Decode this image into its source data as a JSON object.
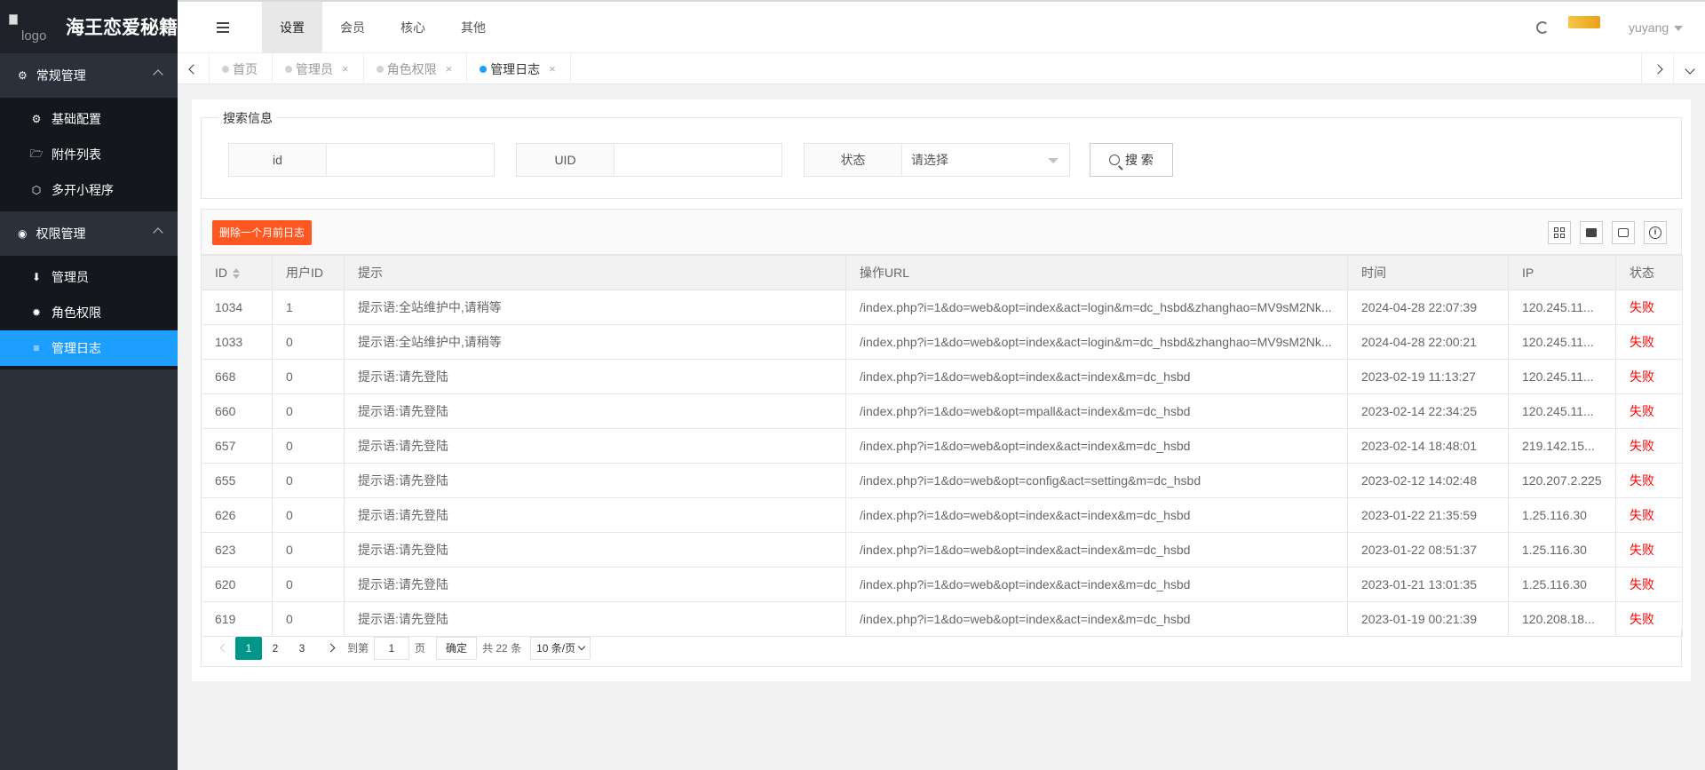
{
  "sidebar": {
    "logo_alt": "logo",
    "title": "海王恋爱秘籍",
    "groups": [
      {
        "label": "常规管理",
        "items": [
          {
            "label": "基础配置"
          },
          {
            "label": "附件列表"
          },
          {
            "label": "多开小程序"
          }
        ]
      },
      {
        "label": "权限管理",
        "items": [
          {
            "label": "管理员"
          },
          {
            "label": "角色权限"
          },
          {
            "label": "管理日志"
          }
        ]
      }
    ]
  },
  "topbar": {
    "nav": [
      "设置",
      "会员",
      "核心",
      "其他"
    ],
    "active_nav": "设置",
    "user": "yuyang"
  },
  "tabs": [
    {
      "label": "首页"
    },
    {
      "label": "管理员"
    },
    {
      "label": "角色权限"
    },
    {
      "label": "管理日志"
    }
  ],
  "search": {
    "legend": "搜索信息",
    "fields": [
      {
        "label": "id",
        "value": ""
      },
      {
        "label": "UID",
        "value": ""
      },
      {
        "label": "状态",
        "placeholder": "请选择"
      }
    ],
    "button": "搜 索"
  },
  "toolbar": {
    "delete_button": "删除一个月前日志"
  },
  "table": {
    "columns": [
      "ID",
      "用户ID",
      "提示",
      "操作URL",
      "时间",
      "IP",
      "状态"
    ],
    "rows": [
      {
        "id": "1034",
        "uid": "1",
        "tip": "提示语:全站维护中,请稍等",
        "url": "/index.php?i=1&do=web&opt=index&act=login&m=dc_hsbd&zhanghao=MV9sM2Nk...",
        "time": "2024-04-28 22:07:39",
        "ip": "120.245.11...",
        "status": "失败"
      },
      {
        "id": "1033",
        "uid": "0",
        "tip": "提示语:全站维护中,请稍等",
        "url": "/index.php?i=1&do=web&opt=index&act=login&m=dc_hsbd&zhanghao=MV9sM2Nk...",
        "time": "2024-04-28 22:00:21",
        "ip": "120.245.11...",
        "status": "失败"
      },
      {
        "id": "668",
        "uid": "0",
        "tip": "提示语:请先登陆",
        "url": "/index.php?i=1&do=web&opt=index&act=index&m=dc_hsbd",
        "time": "2023-02-19 11:13:27",
        "ip": "120.245.11...",
        "status": "失败"
      },
      {
        "id": "660",
        "uid": "0",
        "tip": "提示语:请先登陆",
        "url": "/index.php?i=1&do=web&opt=mpall&act=index&m=dc_hsbd",
        "time": "2023-02-14 22:34:25",
        "ip": "120.245.11...",
        "status": "失败"
      },
      {
        "id": "657",
        "uid": "0",
        "tip": "提示语:请先登陆",
        "url": "/index.php?i=1&do=web&opt=index&act=index&m=dc_hsbd",
        "time": "2023-02-14 18:48:01",
        "ip": "219.142.15...",
        "status": "失败"
      },
      {
        "id": "655",
        "uid": "0",
        "tip": "提示语:请先登陆",
        "url": "/index.php?i=1&do=web&opt=config&act=setting&m=dc_hsbd",
        "time": "2023-02-12 14:02:48",
        "ip": "120.207.2.225",
        "status": "失败"
      },
      {
        "id": "626",
        "uid": "0",
        "tip": "提示语:请先登陆",
        "url": "/index.php?i=1&do=web&opt=index&act=index&m=dc_hsbd",
        "time": "2023-01-22 21:35:59",
        "ip": "1.25.116.30",
        "status": "失败"
      },
      {
        "id": "623",
        "uid": "0",
        "tip": "提示语:请先登陆",
        "url": "/index.php?i=1&do=web&opt=index&act=index&m=dc_hsbd",
        "time": "2023-01-22 08:51:37",
        "ip": "1.25.116.30",
        "status": "失败"
      },
      {
        "id": "620",
        "uid": "0",
        "tip": "提示语:请先登陆",
        "url": "/index.php?i=1&do=web&opt=index&act=index&m=dc_hsbd",
        "time": "2023-01-21 13:01:35",
        "ip": "1.25.116.30",
        "status": "失败"
      },
      {
        "id": "619",
        "uid": "0",
        "tip": "提示语:请先登陆",
        "url": "/index.php?i=1&do=web&opt=index&act=index&m=dc_hsbd",
        "time": "2023-01-19 00:21:39",
        "ip": "120.208.18...",
        "status": "失败"
      }
    ]
  },
  "pagination": {
    "pages": [
      "1",
      "2",
      "3"
    ],
    "current": "1",
    "goto_label": "到第",
    "goto_value": "1",
    "page_unit": "页",
    "confirm": "确定",
    "total": "共 22 条",
    "page_size": "10 条/页"
  },
  "colors": {
    "sidebar_bg": "#2a313b",
    "active_menu": "#1e9fff",
    "danger": "#ff5722",
    "pager_current": "#009688",
    "fail": "#ff0000"
  }
}
